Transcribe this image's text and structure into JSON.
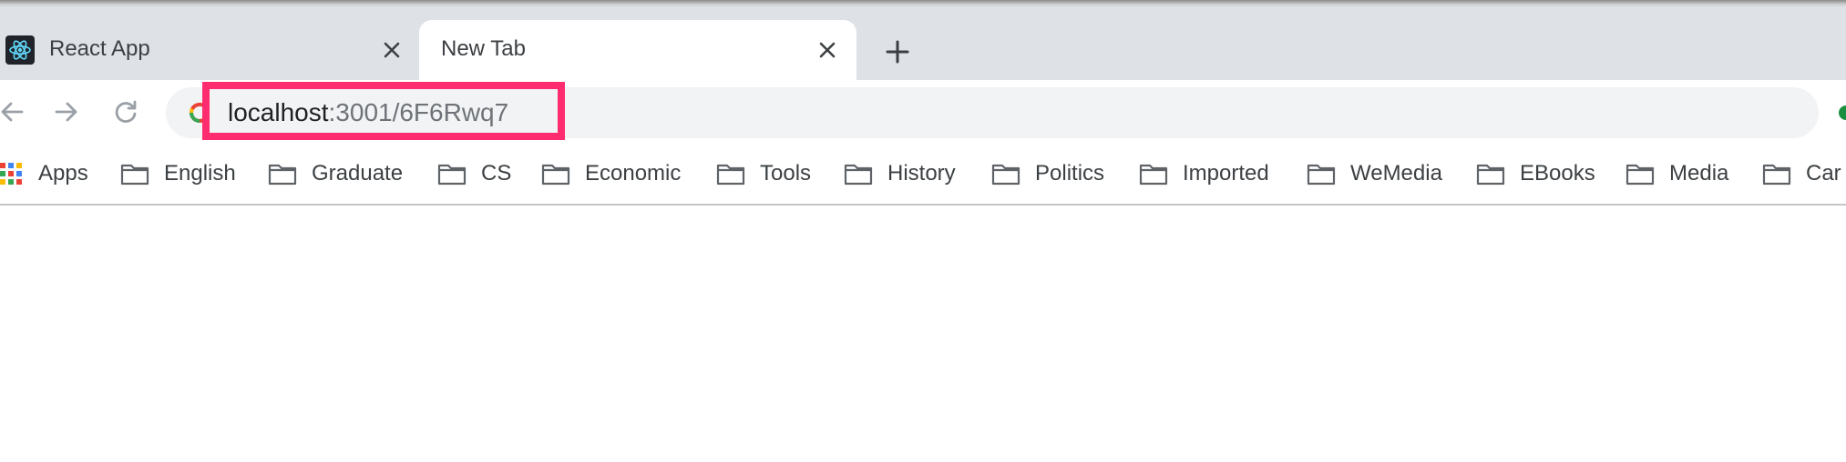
{
  "tabs": [
    {
      "title": "React App",
      "favicon": "react-icon",
      "active": false
    },
    {
      "title": "New Tab",
      "favicon": "",
      "active": true
    }
  ],
  "toolbar": {
    "back_icon": "back-arrow-icon",
    "forward_icon": "forward-arrow-icon",
    "reload_icon": "reload-icon"
  },
  "omnibox": {
    "host": "localhost",
    "rest": ":3001/6F6Rwq7",
    "highlight_color": "#ff2d6f"
  },
  "bookmarks": {
    "apps_label": "Apps",
    "items": [
      "English",
      "Graduate",
      "CS",
      "Economic",
      "Tools",
      "History",
      "Politics",
      "Imported",
      "WeMedia",
      "EBooks",
      "Media",
      "Car"
    ]
  },
  "colors": {
    "tabstrip": "#dee1e6",
    "omnibox_bg": "#f1f3f4",
    "text": "#3c4043"
  }
}
